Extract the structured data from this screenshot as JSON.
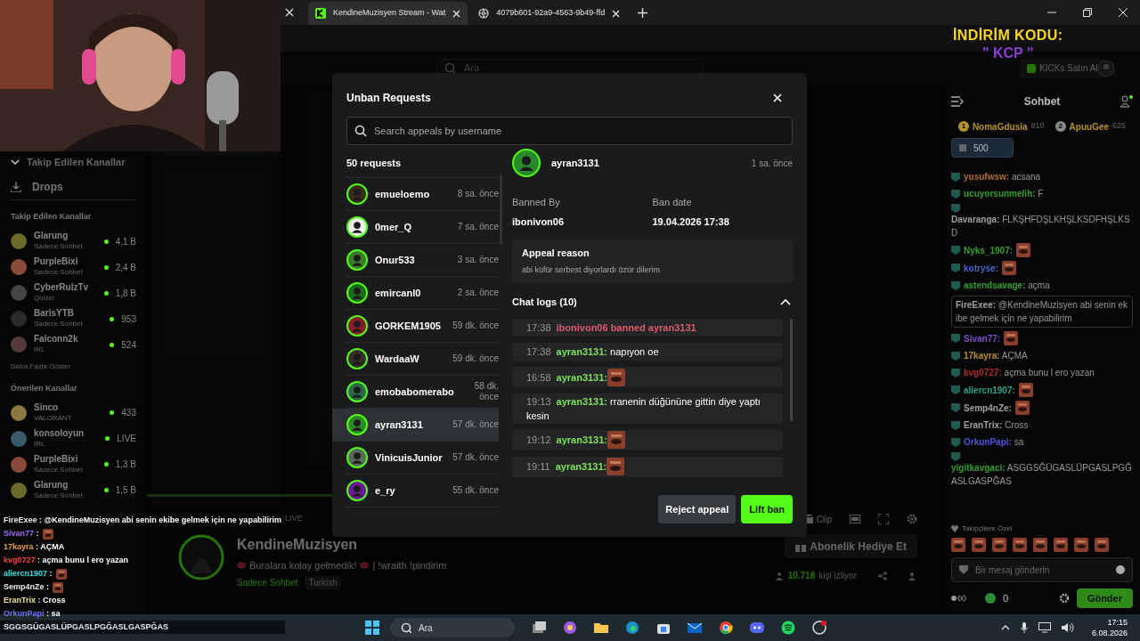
{
  "browser": {
    "tabs": [
      {
        "title": "KendineMuzisyen Stream - Wat",
        "selected": true
      },
      {
        "title": "4079b601-92a9-4563-9b49-ffd",
        "selected": false
      }
    ]
  },
  "promo": {
    "title": "İNDİRİM KODU:",
    "code": "\" KCP \""
  },
  "header": {
    "search_placeholder": "Ara",
    "kicks_button": "KICKs Satın Al"
  },
  "sidebar": {
    "following_toggle": "Takip Edilen Kanallar",
    "drops": "Drops",
    "sections": [
      {
        "title": "Takip Edilen Kanallar",
        "more": "Daha Fazla Göster",
        "channels": [
          {
            "name": "Glarung",
            "category": "Sadece Sohbet",
            "viewers": "4,1 B"
          },
          {
            "name": "PurpleBixi",
            "category": "Sadece Sohbet",
            "viewers": "2,4 B"
          },
          {
            "name": "CyberRulzTv",
            "category": "Quizel",
            "viewers": "1,8 B"
          },
          {
            "name": "BarisYTB",
            "category": "Sadece Sohbet",
            "viewers": "953"
          },
          {
            "name": "Falconn2k",
            "category": "IRL",
            "viewers": "524"
          }
        ]
      },
      {
        "title": "Önerilen Kanallar",
        "channels": [
          {
            "name": "Sinco",
            "category": "VALORANT",
            "viewers": "433"
          },
          {
            "name": "konsoloyun",
            "category": "IRL",
            "viewers": "LIVE"
          },
          {
            "name": "PurpleBixi",
            "category": "Sadece Sohbet",
            "viewers": "1,3 B"
          },
          {
            "name": "Glarung",
            "category": "Sadece Sohbet",
            "viewers": "1,5 B"
          }
        ]
      }
    ]
  },
  "player": {
    "live": "LIVE",
    "clip": "Clip"
  },
  "channel": {
    "name": "KendineMuzisyen",
    "tagline_1": "Buralara kolay gelmedik!",
    "tagline_2": "| !wraith !pindirim",
    "category": "Sadece Sohbet",
    "tag": "Turkish",
    "viewers": "10.718",
    "viewers_label": "kişi izliyor",
    "gift_button": "Abonelik Hediye Et"
  },
  "chat": {
    "title": "Sohbet",
    "leaders": [
      {
        "rank": "1",
        "name": "NomaGdusia",
        "score": "810"
      },
      {
        "rank": "2",
        "name": "ApuuGee",
        "score": "625"
      }
    ],
    "pinned_amount": "500",
    "messages": [
      {
        "user": "yusufwsw:",
        "color": "#b0702e",
        "text": "acsana",
        "emote": false,
        "highlighted": false
      },
      {
        "user": "ucuyorsunmelih:",
        "color": "#33a033",
        "text": "F",
        "emote": false,
        "highlighted": false
      },
      {
        "user": "Davaranga:",
        "color": "#a0a0a0",
        "text": "FLKŞHFDŞLKHŞLKSDFHŞLKSD",
        "emote": false,
        "highlighted": false
      },
      {
        "user": "Nyks_1907:",
        "color": "#33a033",
        "emote": true,
        "highlighted": false
      },
      {
        "user": "kotryse:",
        "color": "#4a64d0",
        "emote": true,
        "highlighted": false
      },
      {
        "user": "astendsavage:",
        "color": "#33a033",
        "text": "açma",
        "emote": false,
        "highlighted": false
      },
      {
        "user": "FireExee:",
        "color": "#a0a0a0",
        "text": "@KendineMuzisyen abi senin ekibe gelmek için ne yapabilirim",
        "emote": false,
        "highlighted": true
      },
      {
        "user": "Sivan77:",
        "color": "#7a50c8",
        "emote": true,
        "highlighted": false
      },
      {
        "user": "17kayra:",
        "color": "#b8902e",
        "text": "AÇMA",
        "emote": false,
        "highlighted": false
      },
      {
        "user": "kvg0727:",
        "color": "#b02a2e",
        "text": "açma bunu l ero yazan",
        "emote": false,
        "highlighted": false
      },
      {
        "user": "aliercn1907:",
        "color": "#2aa08a",
        "emote": true,
        "highlighted": false
      },
      {
        "user": "Semp4nZe:",
        "color": "#a0a0a0",
        "emote": true,
        "highlighted": false
      },
      {
        "user": "EranTrix:",
        "color": "#a0a0a0",
        "text": "Cross",
        "emote": false,
        "highlighted": false
      },
      {
        "user": "OrkunPapi:",
        "color": "#5258d8",
        "text": "sa",
        "emote": false,
        "highlighted": false
      },
      {
        "user": "yigitkavgaci:",
        "color": "#33a033",
        "text": "ASGGSĞÜGASLÜPGASLPGĞASLGASPĞAS",
        "emote": false,
        "highlighted": false
      }
    ],
    "followers_only": "Takipçilere Özel",
    "input_placeholder": "Bir mesaj gönderin",
    "points": "0",
    "send_button": "Gönder"
  },
  "stream_chat": [
    {
      "user": "FireExee",
      "color": "#e8e8e8",
      "text": ": @KendineMuzisyen abi senin ekibe gelmek için ne yapabilirim",
      "emote": false
    },
    {
      "user": "Sivan77",
      "color": "#a66bff",
      "text": ":",
      "emote": true
    },
    {
      "user": "17kayra",
      "color": "#f0a030",
      "text": ": AÇMA",
      "emote": false
    },
    {
      "user": "kvg0727",
      "color": "#ff3b3b",
      "text": ": açma bunu l ero yazan",
      "emote": false
    },
    {
      "user": "aliercn1907",
      "color": "#33e0e0",
      "text": ":",
      "emote": true
    },
    {
      "user": "Semp4nZe",
      "color": "#e8e8e8",
      "text": ":",
      "emote": true
    },
    {
      "user": "EranTrix",
      "color": "#f0e080",
      "text": ": Cross",
      "emote": false
    },
    {
      "user": "OrkunPapi",
      "color": "#6f7bff",
      "text": ": sa",
      "emote": false
    },
    {
      "color": "#e8e8e8",
      "text": "SGGSGÜGASLÜPGASLPGĞASLGASPĞAS",
      "emote": false
    }
  ],
  "modal": {
    "title": "Unban Requests",
    "search_placeholder": "Search appeals by username",
    "count": "50 requests",
    "requests": [
      {
        "name": "emueloemo",
        "time": "8 sa. önce",
        "selected": false
      },
      {
        "name": "0mer_Q",
        "time": "7 sa. önce",
        "selected": false
      },
      {
        "name": "Onur533",
        "time": "3 sa. önce",
        "selected": false
      },
      {
        "name": "emircanl0",
        "time": "2 sa. önce",
        "selected": false
      },
      {
        "name": "GORKEM1905",
        "time": "59 dk. önce",
        "selected": false
      },
      {
        "name": "WardaaW",
        "time": "59 dk. önce",
        "selected": false
      },
      {
        "name": "emobabomerabo",
        "time": "58 dk. önce",
        "selected": false
      },
      {
        "name": "ayran3131",
        "time": "57 dk. önce",
        "selected": true
      },
      {
        "name": "VinicuisJunior",
        "time": "57 dk. önce",
        "selected": false
      },
      {
        "name": "e_ry",
        "time": "55 dk. önce",
        "selected": false
      }
    ],
    "detail": {
      "name": "ayran3131",
      "time": "1 sa. önce",
      "banned_by_label": "Banned By",
      "banned_by": "ibonivon06",
      "ban_date_label": "Ban date",
      "ban_date": "19.04.2026 17:38",
      "appeal_label": "Appeal reason",
      "appeal_text": "abi küfür serbest diyorlardı özür dilerim",
      "logs_title": "Chat logs (10)",
      "logs_expanded": true,
      "logs": [
        {
          "kind": "ban",
          "time": "17:38",
          "text": "ibonivon06 banned ayran3131"
        },
        {
          "kind": "message",
          "time": "17:38",
          "user": "ayran3131:",
          "text": "napıyon oe",
          "emote": false
        },
        {
          "kind": "message",
          "time": "16:58",
          "user": "ayran3131:",
          "emote": true
        },
        {
          "kind": "message",
          "time": "19:13",
          "user": "ayran3131:",
          "text": "rranenin düğününe gittin diye yaptı kesin",
          "emote": false
        },
        {
          "kind": "message",
          "time": "19:12",
          "user": "ayran3131:",
          "emote": true
        },
        {
          "kind": "message",
          "time": "19:11",
          "user": "ayran3131:",
          "emote": true
        }
      ]
    },
    "reject_button": "Reject appeal",
    "lift_button": "Lift ban"
  },
  "taskbar": {
    "search_placeholder": "Ara",
    "time": "17:15",
    "date": "6.08.2026"
  }
}
